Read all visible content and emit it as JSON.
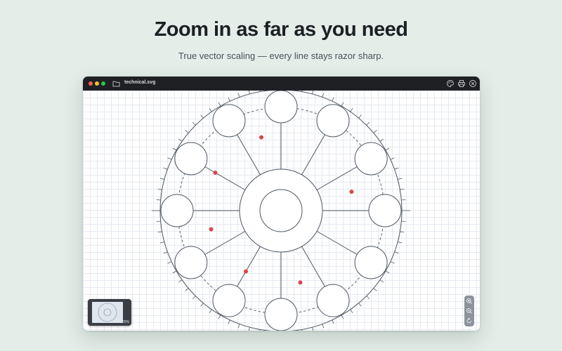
{
  "hero": {
    "headline": "Zoom in as far as you need",
    "subline": "True vector scaling — every line stays razor sharp."
  },
  "window": {
    "filename": "technical.svg",
    "icons": {
      "folder": "folder-icon",
      "palette": "palette-icon",
      "print": "print-icon",
      "close": "close-icon"
    }
  },
  "minimap": {
    "zoom_label": "120%"
  },
  "zoom_controls": [
    "zoom-in-icon",
    "zoom-out-icon",
    "reset-zoom-icon"
  ],
  "colors": {
    "background": "#e4ede8",
    "titlebar": "#1f2024",
    "stroke": "#4d5763",
    "marker": "#d9464c"
  }
}
